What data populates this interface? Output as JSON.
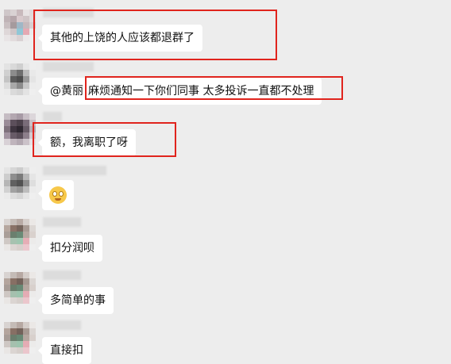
{
  "colors": {
    "background": "#ededed",
    "bubble": "#ffffff",
    "highlight_box": "#e0241d"
  },
  "messages": [
    {
      "text": "其他的上饶的人应该都退群了"
    },
    {
      "mention": "@黄丽",
      "text": "麻烦通知一下你们同事  太多投诉一直都不处理"
    },
    {
      "text": "额，我离职了呀"
    },
    {
      "emoji": "grinning-face-emoji"
    },
    {
      "text": "扣分润呗"
    },
    {
      "text": "多简单的事"
    },
    {
      "text": "直接扣"
    }
  ]
}
